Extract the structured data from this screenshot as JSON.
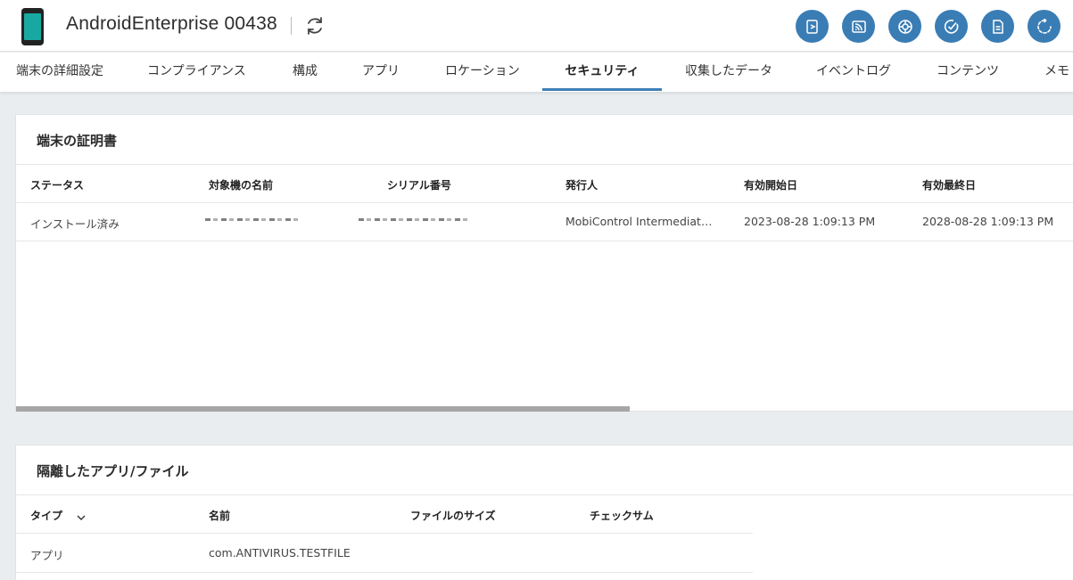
{
  "header": {
    "device_name": "AndroidEnterprise 00438",
    "refresh_icon": "refresh-icon",
    "actions": [
      {
        "name": "remote-control-icon"
      },
      {
        "name": "cast-icon"
      },
      {
        "name": "network-icon"
      },
      {
        "name": "check-icon"
      },
      {
        "name": "document-icon"
      },
      {
        "name": "sync-icon"
      }
    ],
    "accent_color": "#3a7db5",
    "device_screen_color": "#17a9a1"
  },
  "tabs": [
    {
      "label": "端末の詳細設定"
    },
    {
      "label": "コンプライアンス"
    },
    {
      "label": "構成"
    },
    {
      "label": "アプリ"
    },
    {
      "label": "ロケーション"
    },
    {
      "label": "セキュリティ",
      "active": true
    },
    {
      "label": "収集したデータ"
    },
    {
      "label": "イベントログ"
    },
    {
      "label": "コンテンツ"
    },
    {
      "label": "メモ"
    }
  ],
  "certificates": {
    "title": "端末の証明書",
    "columns": [
      "ステータス",
      "対象機の名前",
      "シリアル番号",
      "発行人",
      "有効開始日",
      "有効最終日"
    ],
    "rows": [
      {
        "status": "インストール済み",
        "issuer": "MobiControl Intermediat…",
        "valid_from": "2023-08-28 1:09:13 PM",
        "valid_to": "2028-08-28 1:09:13 PM"
      }
    ]
  },
  "quarantine": {
    "title": "隔離したアプリ/ファイル",
    "columns": [
      "タイプ",
      "名前",
      "ファイルのサイズ",
      "チェックサム"
    ],
    "rows": [
      {
        "type": "アプリ",
        "name": "com.ANTIVIRUS.TESTFILE",
        "size": "",
        "checksum": ""
      }
    ]
  }
}
